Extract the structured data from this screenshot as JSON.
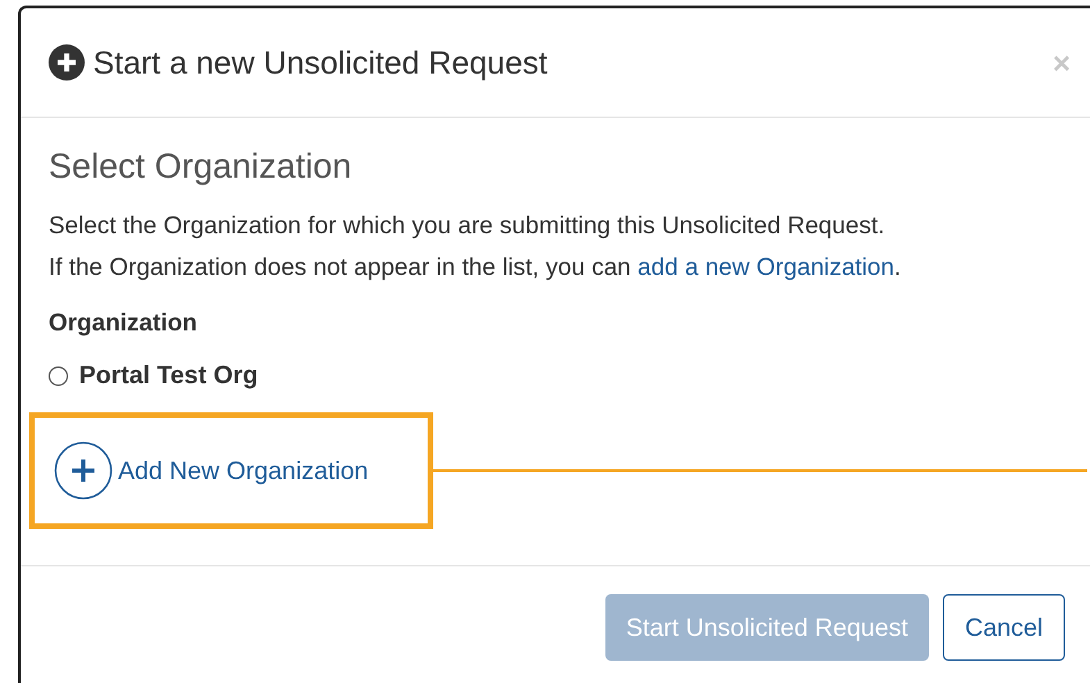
{
  "modal": {
    "title": "Start a new Unsolicited Request",
    "close": "×"
  },
  "section_title": "Select Organization",
  "intro": {
    "line_1": "Select the Organization for which you are submitting this Unsolicited Request.",
    "line_2": "If the Organization does not appear in the list, you can",
    "link": "add a new Organization",
    "end": "."
  },
  "field_label": "Organization",
  "options": [
    {
      "label": "Portal Test Org",
      "selected": false
    }
  ],
  "add_button": {
    "label": "Add New Organization",
    "highlighted": true
  },
  "footer_buttons": [
    {
      "kind": "primary",
      "label": "Start Unsolicited Request",
      "disabled": true
    },
    {
      "kind": "default",
      "label": "Cancel",
      "disabled": false
    }
  ]
}
